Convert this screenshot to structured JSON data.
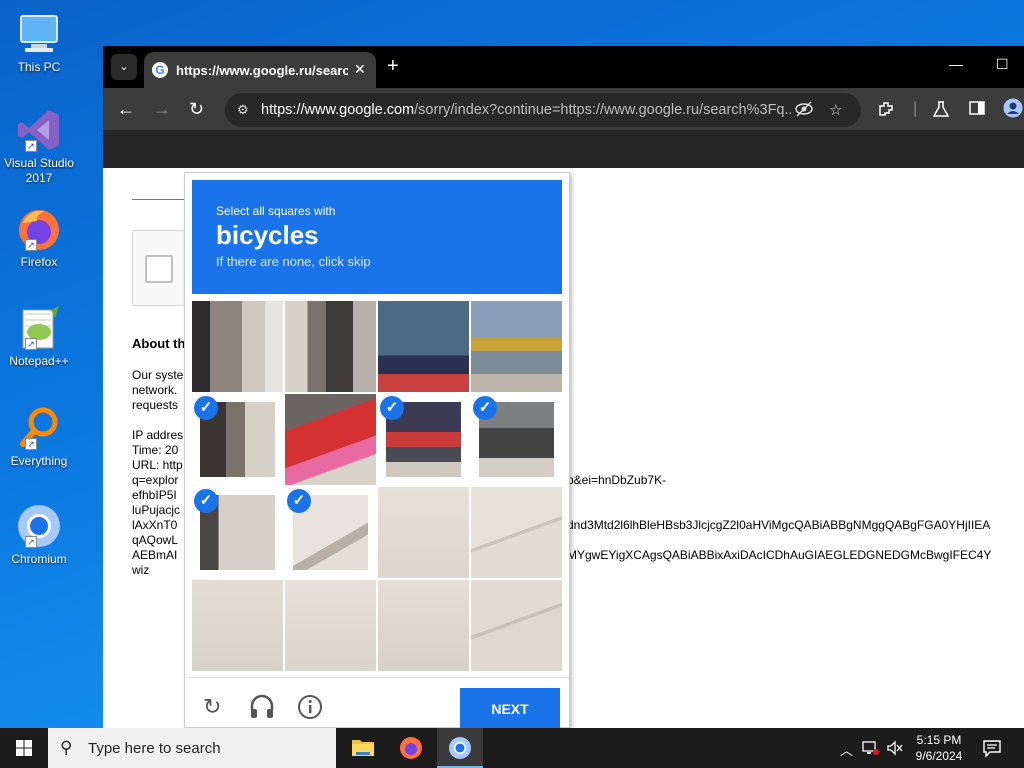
{
  "desktop": {
    "icons": [
      {
        "label": "This PC"
      },
      {
        "label": "Visual Studio 2017"
      },
      {
        "label": "Firefox"
      },
      {
        "label": "Notepad++"
      },
      {
        "label": "Everything"
      },
      {
        "label": "Chromium"
      }
    ]
  },
  "browser": {
    "tab_title": "https://www.google.ru/search",
    "url_host": "https://www.google.com",
    "url_path": "/sorry/index?continue=https://www.google.ru/search%3Fq..."
  },
  "sorry_page": {
    "about_heading": "About th",
    "para_lines": [
      "Our syste",
      "network.",
      "requests"
    ],
    "ip_label": "IP addres",
    "time_label": "Time: 20",
    "url_label": "URL: http",
    "url_lines": [
      "q=explor",
      "efhbIP5I",
      "luPujacjc",
      "lAxXnT0",
      "qAQowL",
      "AEBmAI",
      "wiz"
    ],
    "url_tails": [
      "p&ei=hnDbZub7K-",
      "dnd3Mtd2l6lhBleHBsb3JlcjcgZ2l0aHViMgcQABiABBgNMggQABgFGA0YHjIIEA",
      "MYgwEYigXCAgsQABiABBixAxiDAcICDhAuGIAEGLEDGNEDGMcBwgIFEC4Y"
    ]
  },
  "captcha": {
    "instruction": "Select all squares with",
    "target": "bicycles",
    "hint": "If there are none, click skip",
    "next_label": "NEXT",
    "selected_tiles": [
      4,
      6,
      7,
      8,
      9
    ]
  },
  "taskbar": {
    "search_placeholder": "Type here to search",
    "time": "5:15 PM",
    "date": "9/6/2024"
  }
}
